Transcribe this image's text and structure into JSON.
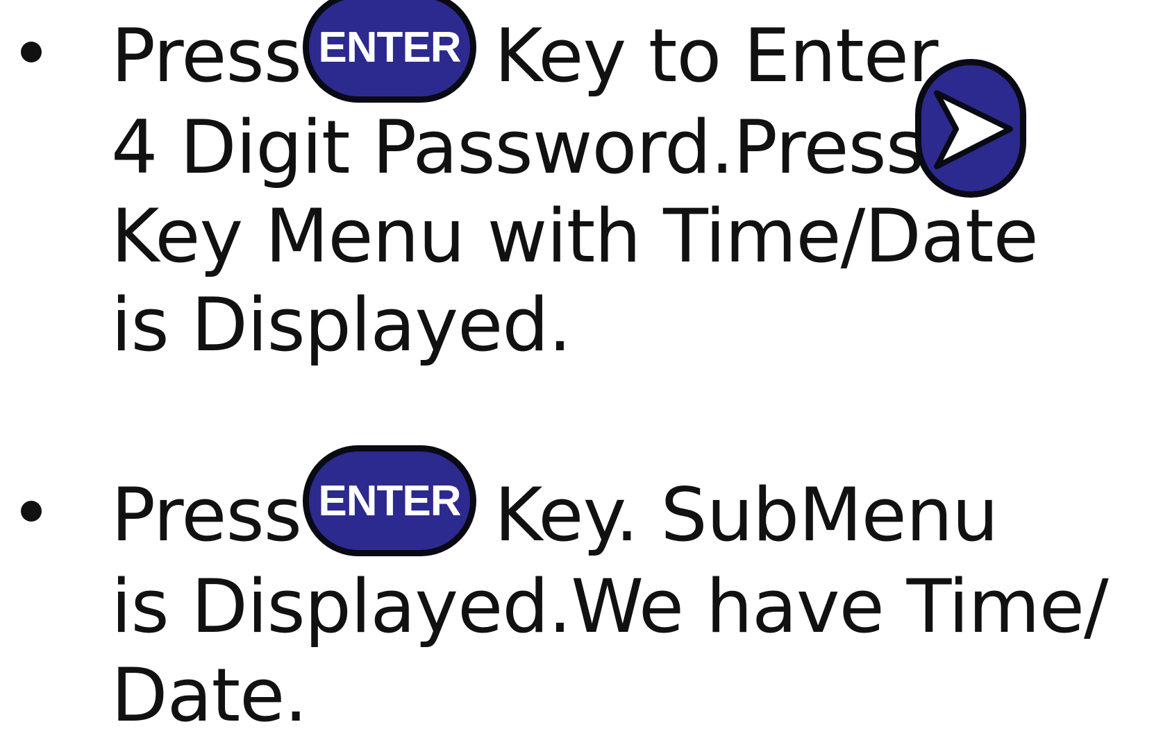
{
  "instructions": [
    {
      "lines": [
        [
          "Press",
          "Key to Enter"
        ],
        [
          "4 Digit Password.Press"
        ],
        [
          "Key Menu with Time/Date"
        ],
        [
          "is Displayed."
        ]
      ]
    },
    {
      "lines": [
        [
          "Press",
          "Key. SubMenu"
        ],
        [
          "is Displayed.We have Time/"
        ],
        [
          "Date."
        ]
      ]
    }
  ],
  "keys": {
    "enter_label": "ENTER",
    "right_arrow": "right-arrow-icon"
  },
  "colors": {
    "key_fill": "#2c2a8f",
    "key_border": "#0a0a14",
    "text": "#111111"
  }
}
